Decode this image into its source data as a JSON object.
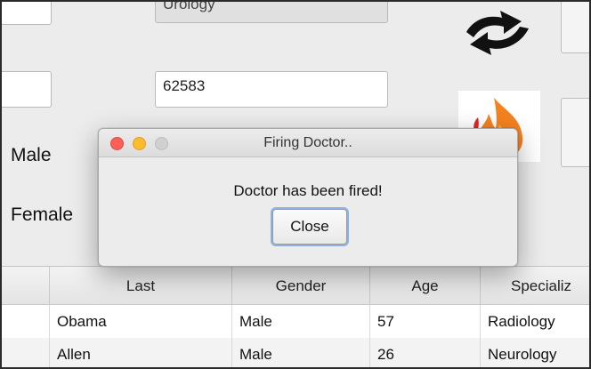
{
  "form": {
    "specialization_value": "Urology",
    "id_value": "62583",
    "gender_options": [
      "Male",
      "Female"
    ]
  },
  "icons": {
    "refresh": "refresh-icon",
    "fire": "fire-icon"
  },
  "table": {
    "columns": [
      "Last",
      "Gender",
      "Age",
      "Specializ"
    ],
    "rows": [
      {
        "last": "Obama",
        "gender": "Male",
        "age": "57",
        "specialization": "Radiology"
      },
      {
        "last": "Allen",
        "gender": "Male",
        "age": "26",
        "specialization": "Neurology"
      }
    ]
  },
  "dialog": {
    "title": "Firing Doctor..",
    "message": "Doctor has been fired!",
    "close_label": "Close"
  },
  "colors": {
    "traffic_close": "#fc5f57",
    "traffic_minimize": "#fdbc2e",
    "focus_ring": "#8db2e0"
  }
}
